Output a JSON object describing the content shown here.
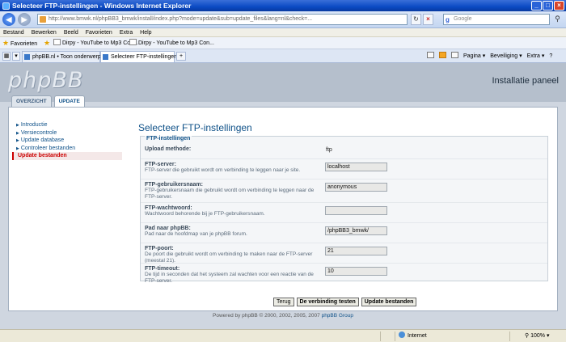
{
  "window": {
    "title": "Selecteer FTP-instellingen - Windows Internet Explorer",
    "controls": {
      "minimize": "_",
      "maximize": "□",
      "close": "×"
    }
  },
  "address_bar": {
    "url": "http://www.bmwk.nl/phpBB3_bmwk/install/index.php?mode=update&sub=update_files&lang=nl&check=..."
  },
  "search": {
    "engine_label": "g",
    "placeholder": "Google"
  },
  "menu": [
    "Bestand",
    "Bewerken",
    "Beeld",
    "Favorieten",
    "Extra",
    "Help"
  ],
  "favorites_bar": {
    "label": "Favorieten",
    "items": [
      "Dirpy - YouTube to Mp3 Con...",
      "Dirpy - YouTube to Mp3 Con..."
    ]
  },
  "tabs": [
    {
      "label": "phpBB.nl • Toon onderwerp - ..."
    },
    {
      "label": "Selecteer FTP-instellingen"
    }
  ],
  "command_bar": [
    "Pagina ▾",
    "Beveiliging ▾",
    "Extra ▾",
    "?"
  ],
  "header": {
    "logo": "phpBB",
    "panel_title": "Installatie paneel"
  },
  "nav_tabs": [
    "OVERZICHT",
    "UPDATE"
  ],
  "sidebar": {
    "items": [
      {
        "label": "Introductie"
      },
      {
        "label": "Versiecontrole"
      },
      {
        "label": "Update database"
      },
      {
        "label": "Controleer bestanden"
      },
      {
        "label": "Update bestanden"
      }
    ]
  },
  "main": {
    "heading": "Selecteer FTP-instellingen",
    "legend": "FTP-instellingen",
    "fields": [
      {
        "label": "Upload methode:",
        "desc": "",
        "value": "ftp"
      },
      {
        "label": "FTP-server:",
        "desc": "FTP-server die gebruikt wordt om verbinding te leggen naar je site.",
        "value": "localhost"
      },
      {
        "label": "FTP-gebruikersnaam:",
        "desc": "FTP-gebruikersnaam die gebruikt wordt om verbinding te leggen naar de FTP-server.",
        "value": "anonymous"
      },
      {
        "label": "FTP-wachtwoord:",
        "desc": "Wachtwoord behorende bij je FTP-gebruikersnaam.",
        "value": ""
      },
      {
        "label": "Pad naar phpBB:",
        "desc": "Pad naar de hoofdmap van je phpBB forum.",
        "value": "/phpBB3_bmwk/"
      },
      {
        "label": "FTP-poort:",
        "desc": "De poort die gebruikt wordt om verbinding te maken naar de FTP-server (meestal 21).",
        "value": "21"
      },
      {
        "label": "FTP-timeout:",
        "desc": "De tijd in seconden dat het systeem zal wachten voor een reactie van de FTP-server.",
        "value": "10"
      }
    ],
    "buttons": {
      "back": "Terug",
      "test": "De verbinding testen",
      "update": "Update bestanden"
    }
  },
  "footer": {
    "text": "Powered by phpBB © 2000, 2002, 2005, 2007",
    "link": "phpBB Group"
  },
  "status_bar": {
    "zone": "Internet",
    "zoom": "100%"
  }
}
